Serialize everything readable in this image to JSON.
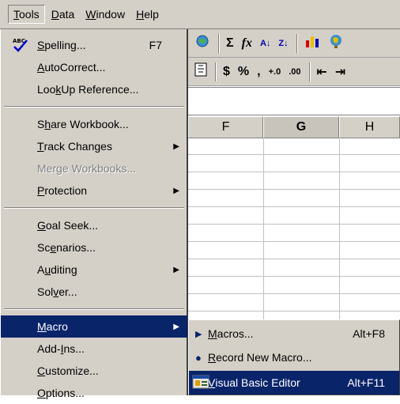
{
  "menubar": {
    "items": [
      {
        "label": "Tools",
        "ul": "T",
        "rest": "ools"
      },
      {
        "label": "Data",
        "ul": "D",
        "rest": "ata"
      },
      {
        "label": "Window",
        "ul": "W",
        "rest": "indow"
      },
      {
        "label": "Help",
        "ul": "H",
        "rest": "elp"
      }
    ]
  },
  "toolbar": {
    "sum_icon": "Σ",
    "fx_icon": "fx",
    "sort_asc_icon": "A↓",
    "sort_desc_icon": "Z↓",
    "currency_icon": "$",
    "percent_icon": "%",
    "comma_icon": ",",
    "inc_decimal_icon": "+.0",
    "dec_decimal_icon": ".00",
    "indent_dec_icon": "⇤",
    "indent_inc_icon": "⇥"
  },
  "columns": [
    "F",
    "G",
    "H"
  ],
  "selected_column": "G",
  "tools_menu": {
    "spelling": {
      "ul": "S",
      "rest": "pelling...",
      "shortcut": "F7"
    },
    "autocorrect": {
      "ul": "A",
      "rest": "utoCorrect..."
    },
    "lookup_pre": "Loo",
    "lookup_ul": "k",
    "lookup_post": " Up Reference...",
    "share_pre": "S",
    "share_ul": "h",
    "share_post": "are Workbook...",
    "track": {
      "ul": "T",
      "rest": "rack Changes"
    },
    "merge": "Merge Workbooks...",
    "protection": {
      "ul": "P",
      "rest": "rotection"
    },
    "goalseek": {
      "ul": "G",
      "rest": "oal Seek..."
    },
    "scenarios_pre": "Sc",
    "scenarios_ul": "e",
    "scenarios_post": "narios...",
    "auditing_pre": "A",
    "auditing_ul": "u",
    "auditing_post": "diting",
    "solver_pre": "Sol",
    "solver_ul": "v",
    "solver_post": "er...",
    "macro": {
      "ul": "M",
      "rest": "acro"
    },
    "addins_pre": "Add-",
    "addins_ul": "I",
    "addins_post": "ns...",
    "customize": {
      "ul": "C",
      "rest": "ustomize..."
    },
    "options": {
      "ul": "O",
      "rest": "ptions..."
    }
  },
  "macro_submenu": {
    "macros": {
      "ul": "M",
      "rest": "acros...",
      "shortcut": "Alt+F8"
    },
    "record": {
      "ul": "R",
      "rest": "ecord New Macro..."
    },
    "vbe": {
      "ul": "V",
      "rest": "isual Basic Editor",
      "shortcut": "Alt+F11"
    }
  },
  "colors": {
    "highlight": "#0a246a",
    "menu_bg": "#d4d0c8"
  }
}
